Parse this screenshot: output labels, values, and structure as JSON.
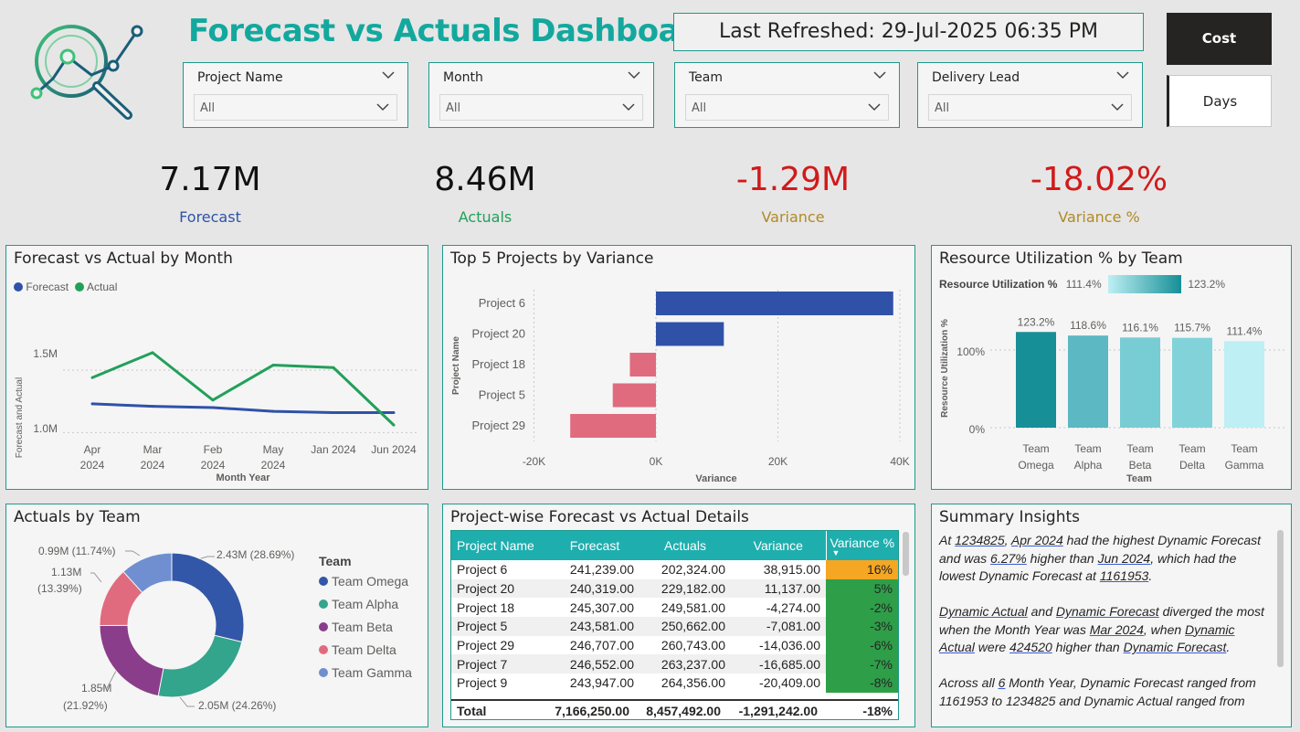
{
  "header": {
    "title": "Forecast vs Actuals Dashboard",
    "last_refreshed": "Last Refreshed: 29-Jul-2025 06:35 PM",
    "cost_button": "Cost",
    "days_button": "Days"
  },
  "slicers": [
    {
      "label": "Project Name",
      "value": "All"
    },
    {
      "label": "Month",
      "value": "All"
    },
    {
      "label": "Team",
      "value": "All"
    },
    {
      "label": "Delivery Lead",
      "value": "All"
    }
  ],
  "kpis": {
    "forecast": {
      "value": "7.17M",
      "label": "Forecast"
    },
    "actuals": {
      "value": "8.46M",
      "label": "Actuals"
    },
    "variance": {
      "value": "-1.29M",
      "label": "Variance"
    },
    "variance_pct": {
      "value": "-18.02%",
      "label": "Variance %"
    }
  },
  "colors": {
    "teal": "#1d9a8c",
    "title": "#13a89e",
    "forecast": "#2f52a8",
    "actual": "#22a05a",
    "negative": "#d11a1a",
    "gold": "#b08a26"
  },
  "line_chart": {
    "title": "Forecast vs Actual by Month",
    "legend": [
      "Forecast",
      "Actual"
    ],
    "ylabel": "Forecast and Actual",
    "xlabel": "Month Year",
    "x_labels": [
      [
        "Apr",
        "2024"
      ],
      [
        "Mar",
        "2024"
      ],
      [
        "Feb",
        "2024"
      ],
      [
        "May",
        "2024"
      ],
      [
        "Jan 2024",
        ""
      ],
      [
        "Jun 2024",
        ""
      ]
    ],
    "y_ticks": [
      "1.5M",
      "1.0M"
    ]
  },
  "bar_chart": {
    "title": "Top 5 Projects by Variance",
    "ylabel": "Project Name",
    "xlabel": "Variance",
    "x_ticks": [
      "-20K",
      "0K",
      "20K",
      "40K"
    ]
  },
  "util_chart": {
    "title": "Resource Utilization % by Team",
    "legend_label": "Resource Utilization %",
    "legend_min": "111.4%",
    "legend_max": "123.2%",
    "ylabel": "Resource Utilization %",
    "xlabel": "Team",
    "y_ticks": [
      "100%",
      "0%"
    ]
  },
  "donut": {
    "title": "Actuals by Team",
    "legend_title": "Team",
    "labels": [
      "2.43M (28.69%)",
      "2.05M (24.26%)",
      "1.85M",
      "(21.92%)",
      "1.13M",
      "(13.39%)",
      "0.99M (11.74%)"
    ]
  },
  "chart_data": [
    {
      "type": "line",
      "title": "Forecast vs Actual by Month",
      "categories": [
        "Apr 2024",
        "Mar 2024",
        "Feb 2024",
        "May 2024",
        "Jan 2024",
        "Jun 2024"
      ],
      "ylim": [
        0.9,
        1.8
      ],
      "series": [
        {
          "name": "Forecast",
          "color": "#2f52a8",
          "values": [
            1.23,
            1.21,
            1.2,
            1.17,
            1.16,
            1.16
          ]
        },
        {
          "name": "Actual",
          "color": "#22a05a",
          "values": [
            1.44,
            1.64,
            1.26,
            1.54,
            1.52,
            1.06
          ]
        }
      ]
    },
    {
      "type": "bar",
      "title": "Top 5 Projects by Variance",
      "categories": [
        "Project 6",
        "Project 20",
        "Project 18",
        "Project 5",
        "Project 29"
      ],
      "values": [
        38915,
        11137,
        -4274,
        -7081,
        -14056
      ],
      "xlim": [
        -20000,
        40000
      ]
    },
    {
      "type": "bar",
      "title": "Resource Utilization % by Team",
      "categories": [
        [
          "Team",
          "Omega"
        ],
        [
          "Team",
          "Alpha"
        ],
        [
          "Team",
          "Beta"
        ],
        [
          "Team",
          "Delta"
        ],
        [
          "Team",
          "Gamma"
        ]
      ],
      "values": [
        123.2,
        118.6,
        116.1,
        115.7,
        111.4
      ],
      "value_labels": [
        "123.2%",
        "118.6%",
        "116.1%",
        "115.7%",
        "111.4%"
      ],
      "colors": [
        "#168f97",
        "#5cb8c2",
        "#78ccd3",
        "#82d3d9",
        "#bdeff4"
      ]
    },
    {
      "type": "pie",
      "title": "Actuals by Team",
      "categories": [
        "Team Omega",
        "Team Alpha",
        "Team Beta",
        "Team Delta",
        "Team Gamma"
      ],
      "values": [
        2.43,
        2.05,
        1.85,
        1.13,
        0.99
      ],
      "percents": [
        28.69,
        24.26,
        21.92,
        13.39,
        11.74
      ],
      "colors": [
        "#3257a8",
        "#33a58c",
        "#8a3d8a",
        "#e06b7f",
        "#6f8fd0"
      ]
    }
  ],
  "table": {
    "title": "Project-wise Forecast vs Actual Details",
    "columns": [
      "Project Name",
      "Forecast",
      "Actuals",
      "Variance",
      "Variance %"
    ],
    "rows": [
      [
        "Project 6",
        "241,239.00",
        "202,324.00",
        "38,915.00",
        "16%"
      ],
      [
        "Project 20",
        "240,319.00",
        "229,182.00",
        "11,137.00",
        "5%"
      ],
      [
        "Project 18",
        "245,307.00",
        "249,581.00",
        "-4,274.00",
        "-2%"
      ],
      [
        "Project 5",
        "243,581.00",
        "250,662.00",
        "-7,081.00",
        "-3%"
      ],
      [
        "Project 29",
        "246,707.00",
        "260,743.00",
        "-14,036.00",
        "-6%"
      ],
      [
        "Project 7",
        "246,552.00",
        "263,237.00",
        "-16,685.00",
        "-7%"
      ],
      [
        "Project 9",
        "243,947.00",
        "264,356.00",
        "-20,409.00",
        "-8%"
      ]
    ],
    "total": [
      "Total",
      "7,166,250.00",
      "8,457,492.00",
      "-1,291,242.00",
      "-18%"
    ]
  },
  "insights": {
    "title": "Summary Insights",
    "p1": [
      "At ",
      "1234825",
      ", ",
      "Apr 2024",
      " had the highest Dynamic Forecast and was ",
      "6.27%",
      " higher than ",
      "Jun 2024",
      ", which had the lowest Dynamic Forecast at ",
      "1161953",
      "."
    ],
    "p2": [
      "Dynamic Actual",
      " and ",
      "Dynamic Forecast",
      " diverged the most when the Month Year was ",
      "Mar 2024",
      ", when ",
      "Dynamic Actual",
      " were ",
      "424520",
      " higher than ",
      "Dynamic Forecast",
      "."
    ],
    "p3": [
      "Across all ",
      "6",
      " Month Year, Dynamic Forecast ranged from ",
      "1161953",
      " to ",
      "1234825",
      " and Dynamic Actual ranged from"
    ]
  }
}
